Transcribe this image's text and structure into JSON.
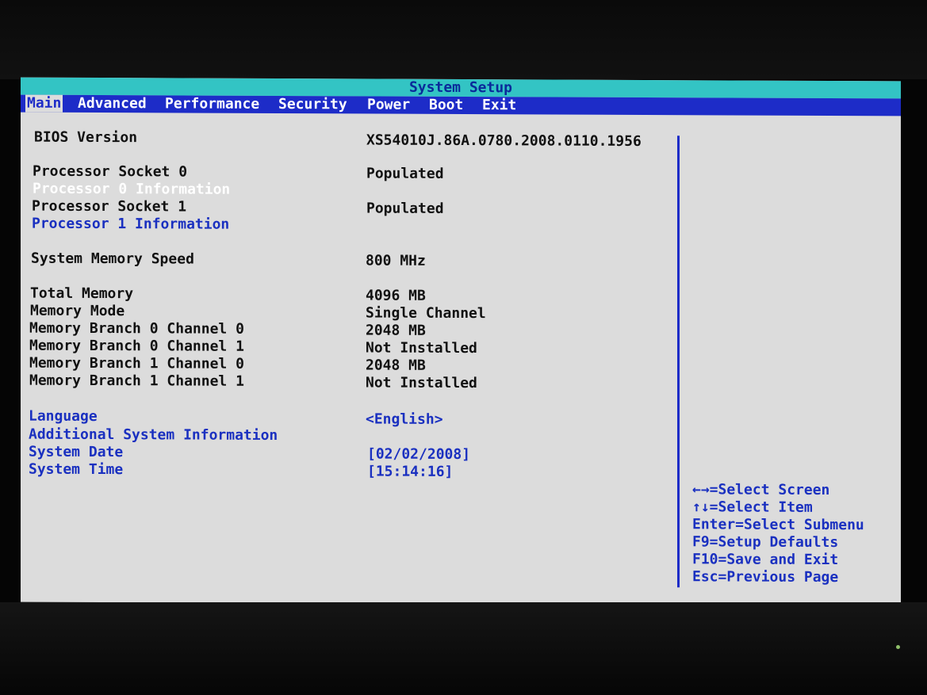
{
  "title": "System Setup",
  "menu": [
    {
      "label": "Main",
      "active": true
    },
    {
      "label": "Advanced"
    },
    {
      "label": "Performance"
    },
    {
      "label": "Security"
    },
    {
      "label": "Power"
    },
    {
      "label": "Boot"
    },
    {
      "label": "Exit"
    }
  ],
  "rows": [
    {
      "label": "BIOS Version",
      "value": "XS54010J.86A.0780.2008.0110.1956"
    },
    {
      "label": "Processor Socket 0",
      "value": "Populated"
    },
    {
      "label": "Processor 0 Information",
      "value": ""
    },
    {
      "label": "Processor Socket 1",
      "value": "Populated"
    },
    {
      "label": "Processor 1 Information",
      "value": ""
    },
    {
      "label": "System Memory Speed",
      "value": "800 MHz"
    },
    {
      "label": "Total Memory",
      "value": "4096 MB"
    },
    {
      "label": "Memory Mode",
      "value": "Single Channel"
    },
    {
      "label": "Memory Branch 0 Channel 0",
      "value": "2048 MB"
    },
    {
      "label": "Memory Branch 0 Channel 1",
      "value": "Not Installed"
    },
    {
      "label": "Memory Branch 1 Channel 0",
      "value": "2048 MB"
    },
    {
      "label": "Memory Branch 1 Channel 1",
      "value": "Not Installed"
    },
    {
      "label": "Language",
      "value": "<English>"
    },
    {
      "label": "Additional System Information",
      "value": ""
    },
    {
      "label": "System Date",
      "value": "[02/02/2008]"
    },
    {
      "label": "System Time",
      "value": "[15:14:16]"
    }
  ],
  "help": [
    "←→=Select Screen",
    "↑↓=Select Item",
    "Enter=Select Submenu",
    "F9=Setup Defaults",
    "F10=Save and Exit",
    "Esc=Previous Page"
  ],
  "colors": {
    "background": "#dcdcdc",
    "title_bar": "#33c4c4",
    "menu_bar": "#1d2cc8",
    "link_text": "#1a30c0",
    "highlight_text": "#ffffff"
  }
}
